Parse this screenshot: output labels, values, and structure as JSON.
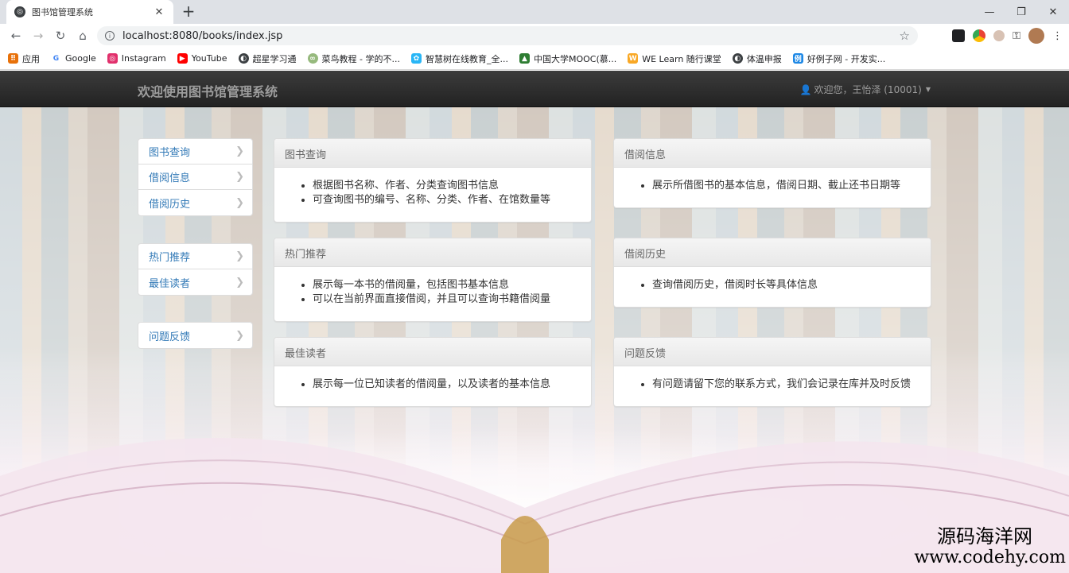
{
  "browser": {
    "tab_title": "图书馆管理系统",
    "url": "localhost:8080/books/index.jsp",
    "bookmarks": [
      {
        "label": "应用",
        "icon": "apps-grid-icon",
        "color": "#e8710a"
      },
      {
        "label": "Google",
        "icon": "google-icon",
        "color": "#4285f4"
      },
      {
        "label": "Instagram",
        "icon": "instagram-icon",
        "color": "#e1306c"
      },
      {
        "label": "YouTube",
        "icon": "youtube-icon",
        "color": "#ff0000"
      },
      {
        "label": "超星学习通",
        "icon": "globe-icon",
        "color": "#3c4043"
      },
      {
        "label": "菜鸟教程 - 学的不...",
        "icon": "runoob-icon",
        "color": "#96b97d"
      },
      {
        "label": "智慧树在线教育_全...",
        "icon": "zhihuishu-icon",
        "color": "#29b6f6"
      },
      {
        "label": "中国大学MOOC(慕...",
        "icon": "mooc-icon",
        "color": "#2e7d32"
      },
      {
        "label": "WE Learn 随行课堂",
        "icon": "welearn-icon",
        "color": "#f9a825"
      },
      {
        "label": "体温申报",
        "icon": "globe-icon",
        "color": "#3c4043"
      },
      {
        "label": "好例子网 - 开发实...",
        "icon": "haolizi-icon",
        "color": "#1e88e5"
      }
    ]
  },
  "navbar": {
    "brand": "欢迎使用图书馆管理系统",
    "user": "欢迎您，王怡泽 (10001)"
  },
  "sidebar": {
    "group1": [
      "图书查询",
      "借阅信息",
      "借阅历史"
    ],
    "group2": [
      "热门推荐",
      "最佳读者"
    ],
    "group3": [
      "问题反馈"
    ]
  },
  "panels": [
    {
      "title": "图书查询",
      "items": [
        "根据图书名称、作者、分类查询图书信息",
        "可查询图书的编号、名称、分类、作者、在馆数量等"
      ]
    },
    {
      "title": "借阅信息",
      "items": [
        "展示所借图书的基本信息，借阅日期、截止还书日期等"
      ]
    },
    {
      "title": "热门推荐",
      "items": [
        "展示每一本书的借阅量，包括图书基本信息",
        "可以在当前界面直接借阅，并且可以查询书籍借阅量"
      ]
    },
    {
      "title": "借阅历史",
      "items": [
        "查询借阅历史，借阅时长等具体信息"
      ]
    },
    {
      "title": "最佳读者",
      "items": [
        "展示每一位已知读者的借阅量，以及读者的基本信息"
      ]
    },
    {
      "title": "问题反馈",
      "items": [
        "有问题请留下您的联系方式，我们会记录在库并及时反馈"
      ]
    }
  ],
  "watermark": {
    "line1": "源码海洋网",
    "line2": "www.codehy.com"
  }
}
